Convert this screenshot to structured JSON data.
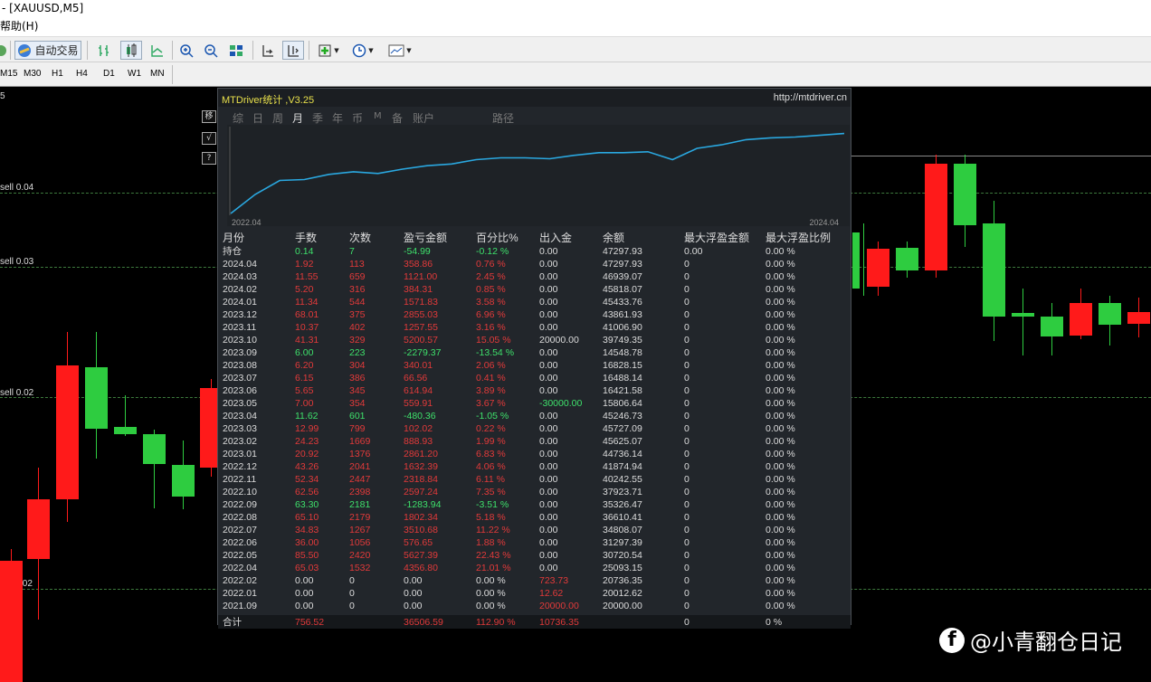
{
  "window": {
    "title": "- [XAUUSD,M5]"
  },
  "menu": {
    "help": "帮助(H)"
  },
  "toolbar": {
    "auto_trade": "自动交易"
  },
  "timeframes": [
    "M15",
    "M30",
    "H1",
    "H4",
    "D1",
    "W1",
    "MN"
  ],
  "chart": {
    "top_label": "5",
    "levels": [
      {
        "label": "sell 0.04"
      },
      {
        "label": "sell 0.03"
      },
      {
        "label": "sell 0.02"
      },
      {
        "label": ".02"
      }
    ],
    "side_buttons": [
      "移",
      "√",
      "?"
    ]
  },
  "panel": {
    "title": "MTDriver统计 ,V3.25",
    "url": "http://mtdriver.cn",
    "tabs": [
      "综",
      "日",
      "周",
      "月",
      "季",
      "年",
      "币",
      "M",
      "备",
      "账户",
      "路径"
    ],
    "active_tab": "月",
    "equity": {
      "start_label": "2022.04",
      "end_label": "2024.04",
      "values": [
        0.0,
        0.22,
        0.38,
        0.39,
        0.45,
        0.48,
        0.46,
        0.51,
        0.55,
        0.57,
        0.62,
        0.64,
        0.64,
        0.63,
        0.67,
        0.7,
        0.7,
        0.71,
        0.62,
        0.75,
        0.79,
        0.85,
        0.87,
        0.88,
        0.9,
        0.92
      ]
    },
    "columns": [
      "月份",
      "手数",
      "次数",
      "盈亏金额",
      "百分比%",
      "出入金",
      "余额",
      "最大浮盈金额",
      "最大浮盈比例"
    ],
    "rows": [
      {
        "c": [
          "持仓",
          "0.14",
          "7",
          "-54.99",
          "-0.12 %",
          "0.00",
          "47297.93",
          "0.00",
          "0.00 %"
        ],
        "tone": "pos"
      },
      {
        "c": [
          "2024.04",
          "1.92",
          "113",
          "358.86",
          "0.76 %",
          "0.00",
          "47297.93",
          "0",
          "0.00 %"
        ],
        "tone": "neg"
      },
      {
        "c": [
          "2024.03",
          "11.55",
          "659",
          "1121.00",
          "2.45 %",
          "0.00",
          "46939.07",
          "0",
          "0.00 %"
        ],
        "tone": "neg"
      },
      {
        "c": [
          "2024.02",
          "5.20",
          "316",
          "384.31",
          "0.85 %",
          "0.00",
          "45818.07",
          "0",
          "0.00 %"
        ],
        "tone": "neg"
      },
      {
        "c": [
          "2024.01",
          "11.34",
          "544",
          "1571.83",
          "3.58 %",
          "0.00",
          "45433.76",
          "0",
          "0.00 %"
        ],
        "tone": "neg"
      },
      {
        "c": [
          "2023.12",
          "68.01",
          "375",
          "2855.03",
          "6.96 %",
          "0.00",
          "43861.93",
          "0",
          "0.00 %"
        ],
        "tone": "neg"
      },
      {
        "c": [
          "2023.11",
          "10.37",
          "402",
          "1257.55",
          "3.16 %",
          "0.00",
          "41006.90",
          "0",
          "0.00 %"
        ],
        "tone": "neg"
      },
      {
        "c": [
          "2023.10",
          "41.31",
          "329",
          "5200.57",
          "15.05 %",
          "20000.00",
          "39749.35",
          "0",
          "0.00 %"
        ],
        "tone": "neg"
      },
      {
        "c": [
          "2023.09",
          "6.00",
          "223",
          "-2279.37",
          "-13.54 %",
          "0.00",
          "14548.78",
          "0",
          "0.00 %"
        ],
        "tone": "pos"
      },
      {
        "c": [
          "2023.08",
          "6.20",
          "304",
          "340.01",
          "2.06 %",
          "0.00",
          "16828.15",
          "0",
          "0.00 %"
        ],
        "tone": "neg"
      },
      {
        "c": [
          "2023.07",
          "6.15",
          "386",
          "66.56",
          "0.41 %",
          "0.00",
          "16488.14",
          "0",
          "0.00 %"
        ],
        "tone": "neg"
      },
      {
        "c": [
          "2023.06",
          "5.65",
          "345",
          "614.94",
          "3.89 %",
          "0.00",
          "16421.58",
          "0",
          "0.00 %"
        ],
        "tone": "neg"
      },
      {
        "c": [
          "2023.05",
          "7.00",
          "354",
          "559.91",
          "3.67 %",
          "-30000.00",
          "15806.64",
          "0",
          "0.00 %"
        ],
        "tone": "neg",
        "cash": "pos"
      },
      {
        "c": [
          "2023.04",
          "11.62",
          "601",
          "-480.36",
          "-1.05 %",
          "0.00",
          "45246.73",
          "0",
          "0.00 %"
        ],
        "tone": "pos"
      },
      {
        "c": [
          "2023.03",
          "12.99",
          "799",
          "102.02",
          "0.22 %",
          "0.00",
          "45727.09",
          "0",
          "0.00 %"
        ],
        "tone": "neg"
      },
      {
        "c": [
          "2023.02",
          "24.23",
          "1669",
          "888.93",
          "1.99 %",
          "0.00",
          "45625.07",
          "0",
          "0.00 %"
        ],
        "tone": "neg"
      },
      {
        "c": [
          "2023.01",
          "20.92",
          "1376",
          "2861.20",
          "6.83 %",
          "0.00",
          "44736.14",
          "0",
          "0.00 %"
        ],
        "tone": "neg"
      },
      {
        "c": [
          "2022.12",
          "43.26",
          "2041",
          "1632.39",
          "4.06 %",
          "0.00",
          "41874.94",
          "0",
          "0.00 %"
        ],
        "tone": "neg"
      },
      {
        "c": [
          "2022.11",
          "52.34",
          "2447",
          "2318.84",
          "6.11 %",
          "0.00",
          "40242.55",
          "0",
          "0.00 %"
        ],
        "tone": "neg"
      },
      {
        "c": [
          "2022.10",
          "62.56",
          "2398",
          "2597.24",
          "7.35 %",
          "0.00",
          "37923.71",
          "0",
          "0.00 %"
        ],
        "tone": "neg"
      },
      {
        "c": [
          "2022.09",
          "63.30",
          "2181",
          "-1283.94",
          "-3.51 %",
          "0.00",
          "35326.47",
          "0",
          "0.00 %"
        ],
        "tone": "pos"
      },
      {
        "c": [
          "2022.08",
          "65.10",
          "2179",
          "1802.34",
          "5.18 %",
          "0.00",
          "36610.41",
          "0",
          "0.00 %"
        ],
        "tone": "neg"
      },
      {
        "c": [
          "2022.07",
          "34.83",
          "1267",
          "3510.68",
          "11.22 %",
          "0.00",
          "34808.07",
          "0",
          "0.00 %"
        ],
        "tone": "neg"
      },
      {
        "c": [
          "2022.06",
          "36.00",
          "1056",
          "576.65",
          "1.88 %",
          "0.00",
          "31297.39",
          "0",
          "0.00 %"
        ],
        "tone": "neg"
      },
      {
        "c": [
          "2022.05",
          "85.50",
          "2420",
          "5627.39",
          "22.43 %",
          "0.00",
          "30720.54",
          "0",
          "0.00 %"
        ],
        "tone": "neg"
      },
      {
        "c": [
          "2022.04",
          "65.03",
          "1532",
          "4356.80",
          "21.01 %",
          "0.00",
          "25093.15",
          "0",
          "0.00 %"
        ],
        "tone": "neg"
      },
      {
        "c": [
          "2022.02",
          "0.00",
          "0",
          "0.00",
          "0.00 %",
          "723.73",
          "20736.35",
          "0",
          "0.00 %"
        ],
        "tone": "zero",
        "cash": "neg"
      },
      {
        "c": [
          "2022.01",
          "0.00",
          "0",
          "0.00",
          "0.00 %",
          "12.62",
          "20012.62",
          "0",
          "0.00 %"
        ],
        "tone": "zero",
        "cash": "neg"
      },
      {
        "c": [
          "2021.09",
          "0.00",
          "0",
          "0.00",
          "0.00 %",
          "20000.00",
          "20000.00",
          "0",
          "0.00 %"
        ],
        "tone": "zero",
        "cash": "neg"
      }
    ],
    "total": {
      "c": [
        "合计",
        "756.52",
        "",
        "36506.59",
        "112.90 %",
        "10736.35",
        "",
        "0",
        "0 %"
      ]
    }
  },
  "watermark": {
    "icon": "f",
    "text": "@小青翻仓日记"
  },
  "colors": {
    "up": "#ff1a1a",
    "down": "#2ecc40",
    "equity": "#2aa8e0",
    "grid": "#3d7a3d"
  }
}
